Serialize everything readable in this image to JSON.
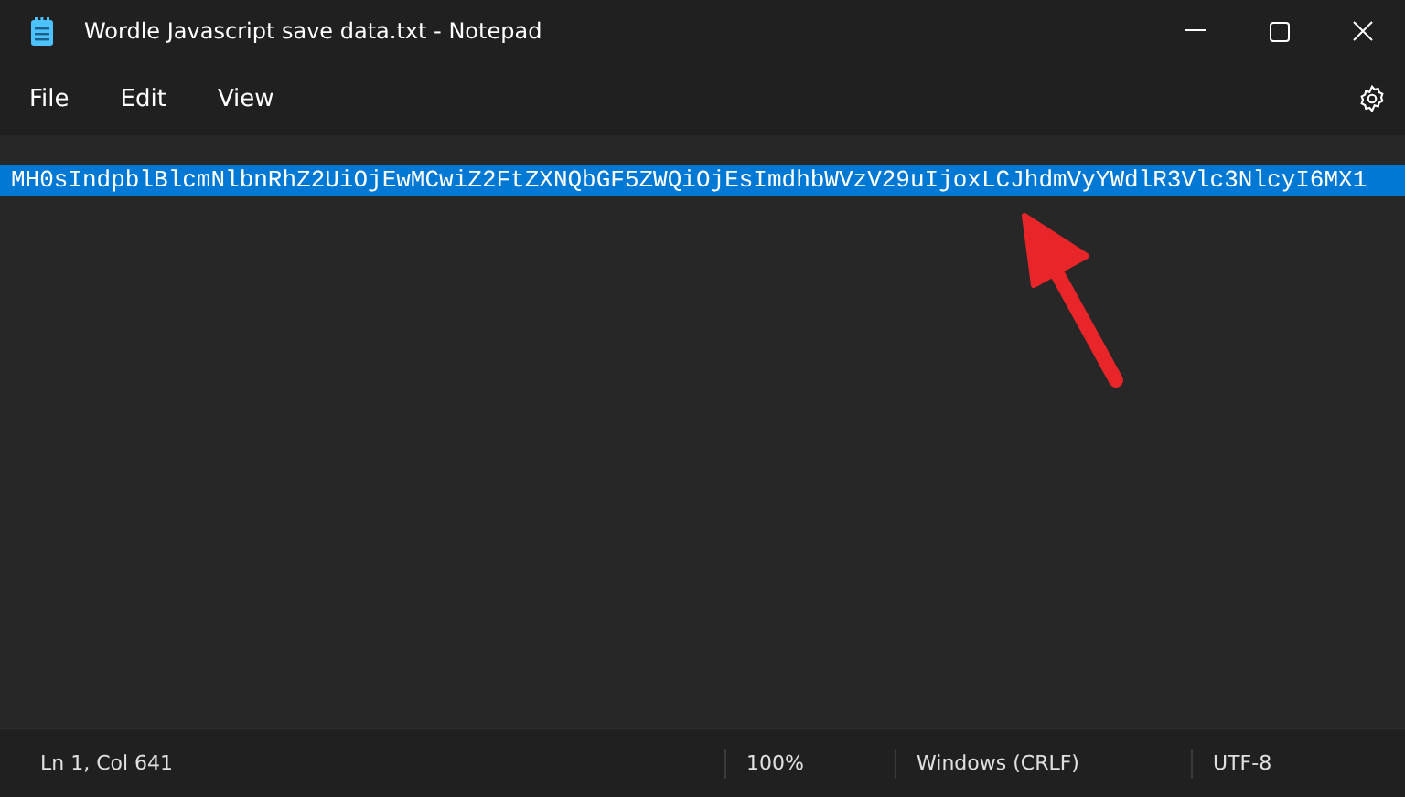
{
  "window": {
    "title": "Wordle Javascript save data.txt - Notepad"
  },
  "menu": [
    "File",
    "Edit",
    "View"
  ],
  "editor": {
    "lines": [
      {
        "text": "MH0sIndpblBlcmNlbnRhZ2UiOjEwMCwiZ2FtZXNQbGF5ZWQiOjEsImdhbWVzV29uIjoxLCJhdmVyYWdlR3Vlc3NlcyI6MX1",
        "selected": true
      }
    ]
  },
  "status_bar": [
    "Ln 1, Col 641",
    "100%",
    "Windows (CRLF)",
    "UTF-8"
  ]
}
